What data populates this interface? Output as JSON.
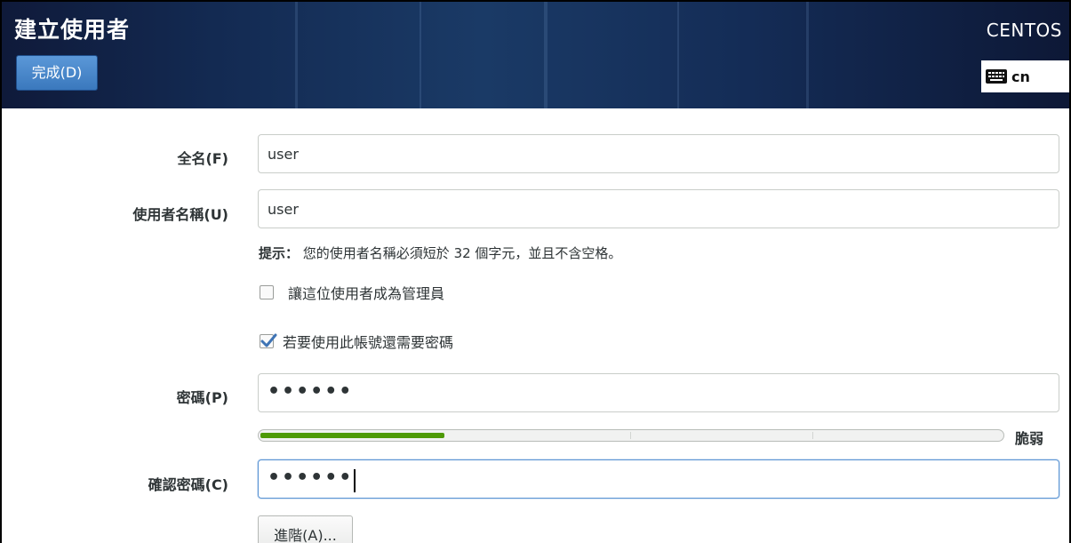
{
  "header": {
    "title": "建立使用者",
    "done_label": "完成(D)",
    "brand": "CENTOS",
    "keyboard_layout": "cn",
    "keyboard_icon": "keyboard-icon"
  },
  "form": {
    "fullname": {
      "label": "全名(F)",
      "value": "user"
    },
    "username": {
      "label": "使用者名稱(U)",
      "value": "user"
    },
    "hint": {
      "prefix": "提示：",
      "text": "您的使用者名稱必須短於 32 個字元，並且不含空格。"
    },
    "admin_checkbox": {
      "label": "讓這位使用者成為管理員",
      "checked": false
    },
    "require_password_checkbox": {
      "label": "若要使用此帳號還需要密碼",
      "checked": true
    },
    "password": {
      "label": "密碼(P)",
      "masked_value": "••••••"
    },
    "strength": {
      "level": 0.25,
      "text": "脆弱",
      "color": "#4e9a06"
    },
    "confirm": {
      "label": "確認密碼(C)",
      "masked_value": "••••••"
    },
    "advanced_label": "進階(A)..."
  }
}
